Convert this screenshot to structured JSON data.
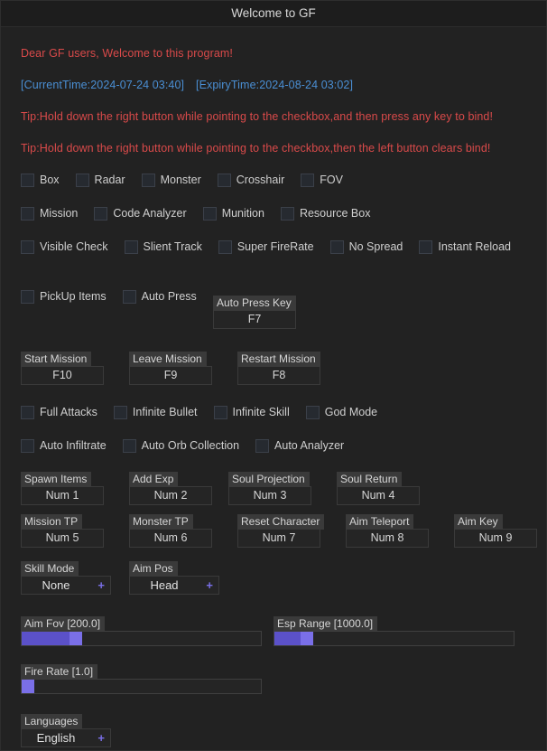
{
  "window": {
    "title": "Welcome to GF"
  },
  "messages": {
    "welcome": "Dear GF users, Welcome to this program!",
    "current_time": "[CurrentTime:2024-07-24 03:40]",
    "expiry_time": "[ExpiryTime:2024-08-24 03:02]",
    "tip_bind": "Tip:Hold down the right button while pointing to the checkbox,and then press any key to bind!",
    "tip_clear": "Tip:Hold down the right button while pointing to the checkbox,then the left button clears bind!"
  },
  "colors": {
    "accent": "#7a6fe8",
    "slider_fill": "#5b51c9",
    "warning_text": "#d94a4a",
    "info_text": "#4a8fd4",
    "window_bg": "#222222",
    "label_bg": "#3a3a3a"
  },
  "checkbox_rows": [
    [
      {
        "label": "Box",
        "checked": false
      },
      {
        "label": "Radar",
        "checked": false
      },
      {
        "label": "Monster",
        "checked": false
      },
      {
        "label": "Crosshair",
        "checked": false
      },
      {
        "label": "FOV",
        "checked": false
      }
    ],
    [
      {
        "label": "Mission",
        "checked": false
      },
      {
        "label": "Code Analyzer",
        "checked": false
      },
      {
        "label": "Munition",
        "checked": false
      },
      {
        "label": "Resource Box",
        "checked": false
      }
    ],
    [
      {
        "label": "Visible Check",
        "checked": false
      },
      {
        "label": "Slient Track",
        "checked": false
      },
      {
        "label": "Super FireRate",
        "checked": false
      },
      {
        "label": "No Spread",
        "checked": false
      },
      {
        "label": "Instant Reload",
        "checked": false
      }
    ]
  ],
  "autopress_row": {
    "checkboxes": [
      {
        "label": "PickUp Items",
        "checked": false
      },
      {
        "label": "Auto Press",
        "checked": false
      }
    ],
    "keybind": {
      "label": "Auto Press Key",
      "value": "F7"
    }
  },
  "mission_keybinds": [
    {
      "label": "Start Mission",
      "value": "F10"
    },
    {
      "label": "Leave Mission",
      "value": "F9"
    },
    {
      "label": "Restart Mission",
      "value": "F8"
    }
  ],
  "combat_rows": [
    [
      {
        "label": "Full Attacks",
        "checked": false
      },
      {
        "label": "Infinite Bullet",
        "checked": false
      },
      {
        "label": "Infinite Skill",
        "checked": false
      },
      {
        "label": "God Mode",
        "checked": false
      }
    ],
    [
      {
        "label": "Auto Infiltrate",
        "checked": false
      },
      {
        "label": "Auto Orb Collection",
        "checked": false
      },
      {
        "label": "Auto Analyzer",
        "checked": false
      }
    ]
  ],
  "num_keybinds_row1": [
    {
      "label": "Spawn Items",
      "value": "Num 1"
    },
    {
      "label": "Add Exp",
      "value": "Num 2"
    },
    {
      "label": "Soul Projection",
      "value": "Num 3"
    },
    {
      "label": "Soul Return",
      "value": "Num 4"
    }
  ],
  "num_keybinds_row2": [
    {
      "label": "Mission TP",
      "value": "Num 5"
    },
    {
      "label": "Monster TP",
      "value": "Num 6"
    },
    {
      "label": "Reset Character",
      "value": "Num 7"
    },
    {
      "label": "Aim Teleport",
      "value": "Num 8"
    },
    {
      "label": "Aim Key",
      "value": "Num 9"
    }
  ],
  "dropdowns": [
    {
      "label": "Skill Mode",
      "value": "None",
      "expand": "+"
    },
    {
      "label": "Aim Pos",
      "value": "Head",
      "expand": "+"
    }
  ],
  "sliders": [
    {
      "label": "Aim Fov [200.0]",
      "value": 200.0,
      "fill_percent": 20,
      "handle_percent": 20
    },
    {
      "label": "Esp Range [1000.0]",
      "value": 1000.0,
      "fill_percent": 11,
      "handle_percent": 11
    },
    {
      "label": "Fire Rate [1.0]",
      "value": 1.0,
      "fill_percent": 0,
      "handle_percent": 0
    }
  ],
  "language": {
    "label": "Languages",
    "value": "English",
    "expand": "+"
  }
}
